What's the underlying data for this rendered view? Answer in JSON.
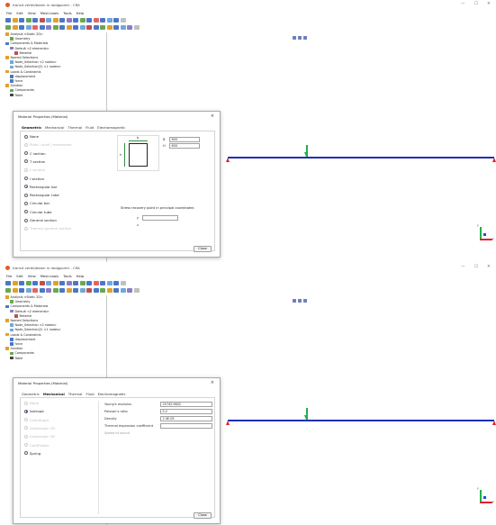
{
  "app": {
    "title": "transit vertel/beam in dodgpointr - CRA",
    "win_controls": [
      "—",
      "☐",
      "✕"
    ]
  },
  "menu": [
    "File",
    "Edit",
    "View",
    "Mesh-tools",
    "Tools",
    "Help"
  ],
  "tree": [
    {
      "label": "Analysis <Static 2D>",
      "indent": 0,
      "icon": "analysis-icon"
    },
    {
      "label": "Geometry",
      "indent": 1,
      "icon": "geometry-icon"
    },
    {
      "label": "Components & Materials",
      "indent": 0,
      "icon": "components-icon"
    },
    {
      "label": "Default <2 elements>",
      "indent": 1,
      "icon": "element-icon"
    },
    {
      "label": "Material",
      "indent": 2,
      "icon": "material-icon"
    },
    {
      "label": "Named Selections",
      "indent": 0,
      "icon": "selection-icon"
    },
    {
      "label": "Node_Selection <2 nodes>",
      "indent": 1,
      "icon": "node-icon"
    },
    {
      "label": "Node_Selection(2) <1 nodes>",
      "indent": 1,
      "icon": "node-icon"
    },
    {
      "label": "Loads & Constraints",
      "indent": 0,
      "icon": "loads-icon"
    },
    {
      "label": "displacement",
      "indent": 1,
      "icon": "displacement-icon"
    },
    {
      "label": "force",
      "indent": 1,
      "icon": "force-icon"
    },
    {
      "label": "Solution",
      "indent": 0,
      "icon": "solution-icon"
    },
    {
      "label": "Components",
      "indent": 1,
      "icon": "components-icon"
    },
    {
      "label": "Table",
      "indent": 1,
      "icon": "table-icon"
    }
  ],
  "dialog": {
    "title": "Material Properties (Material)",
    "close_x": "×",
    "tabs": [
      "Geometric",
      "Mechanical",
      "Thermal",
      "Fluid",
      "Electromagnetic"
    ],
    "close_button": "Close"
  },
  "geometric": {
    "options": [
      {
        "label": "None",
        "selected": false,
        "enabled": true
      },
      {
        "label": "Plate / shell / membrane",
        "selected": false,
        "enabled": false
      },
      {
        "label": "C section",
        "selected": false,
        "enabled": true
      },
      {
        "label": "T section",
        "selected": false,
        "enabled": true
      },
      {
        "label": "L section",
        "selected": false,
        "enabled": false
      },
      {
        "label": "I section",
        "selected": false,
        "enabled": true
      },
      {
        "label": "Rectangular bar",
        "selected": true,
        "enabled": true
      },
      {
        "label": "Rectangular tube",
        "selected": false,
        "enabled": true
      },
      {
        "label": "Circular bar",
        "selected": false,
        "enabled": true
      },
      {
        "label": "Circular tube",
        "selected": false,
        "enabled": true
      },
      {
        "label": "General section",
        "selected": false,
        "enabled": true
      },
      {
        "label": "Thermal general section",
        "selected": false,
        "enabled": false
      }
    ],
    "dim_b_label": "b",
    "dim_h_label": "h",
    "b_label": "B",
    "b_value": "600",
    "h_label": "H",
    "h_value": "600",
    "stress_title": "Stress recovery point in principal coordinates",
    "y_label": "y",
    "z_label": "z"
  },
  "mechanical": {
    "options": [
      {
        "label": "None",
        "selected": false,
        "enabled": false
      },
      {
        "label": "Isotropic",
        "selected": true,
        "enabled": true
      },
      {
        "label": "Orthotropic",
        "selected": false,
        "enabled": false
      },
      {
        "label": "Anisotropic 2D",
        "selected": false,
        "enabled": false
      },
      {
        "label": "Anisotropic 3D",
        "selected": false,
        "enabled": false
      },
      {
        "label": "Cart/Plastic",
        "selected": false,
        "enabled": false
      },
      {
        "label": "Spring",
        "selected": false,
        "enabled": true
      }
    ],
    "fields": [
      {
        "label": "Young's modulus",
        "value": "25742.9602"
      },
      {
        "label": "Poisson's ratio",
        "value": "0.2"
      },
      {
        "label": "Density",
        "value": "2.4E-05"
      },
      {
        "label": "Thermal expansion coefficient",
        "value": ""
      },
      {
        "label": "Speed of sound",
        "value": ""
      }
    ]
  },
  "axes": {
    "x": "x",
    "y": "y",
    "z": "z"
  },
  "colors": {
    "beam": "#1e2fb3",
    "support": "#e0202f",
    "load": "#22b14c",
    "radio_on": "#1a4fd6"
  }
}
